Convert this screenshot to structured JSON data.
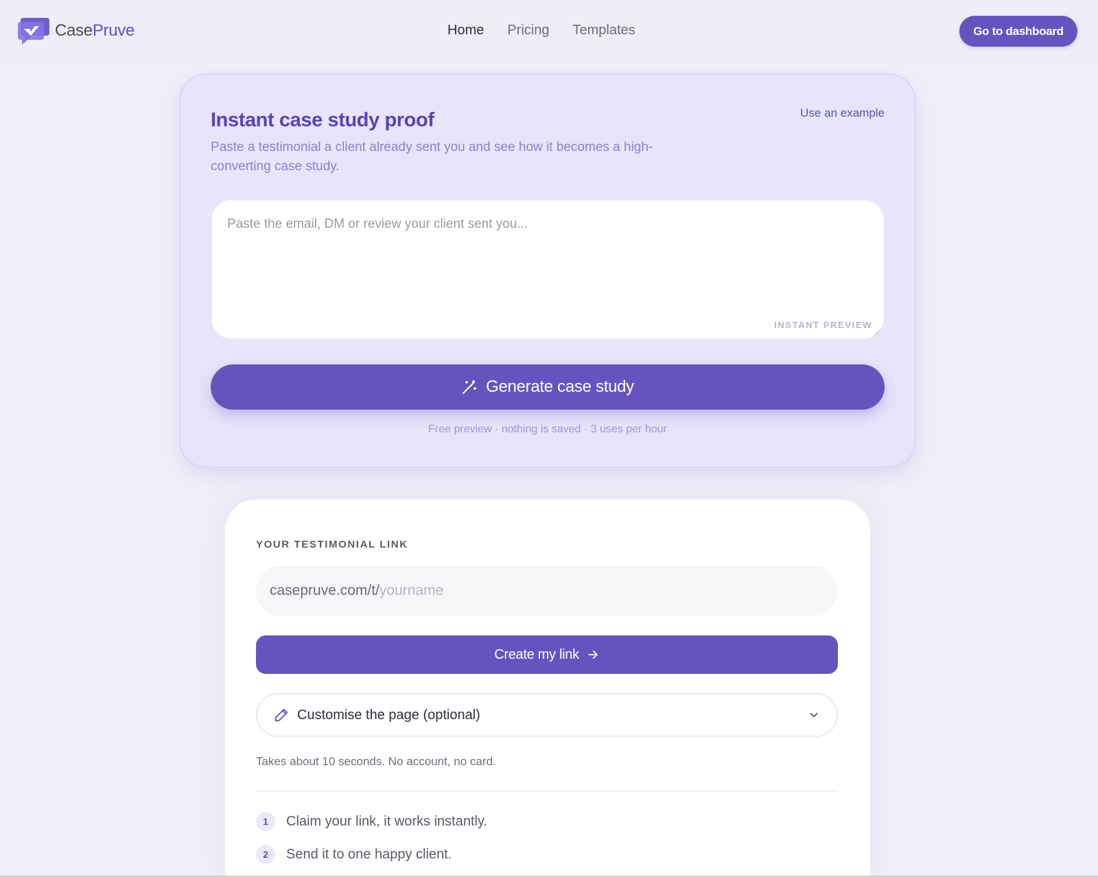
{
  "brand": {
    "case": "Case",
    "pruve": "Pruve"
  },
  "nav": {
    "home": "Home",
    "pricing": "Pricing",
    "templates": "Templates"
  },
  "header": {
    "dashboard_label": "Go to dashboard"
  },
  "case_study": {
    "title": "Instant case study proof",
    "example_link": "Use an example",
    "subtitle": "Paste a testimonial a client already sent you and see how it becomes a high-converting case study.",
    "textarea_placeholder": "Paste the email, DM or review your client sent you...",
    "instant_tag": "INSTANT PREVIEW",
    "generate_label": "Generate case study",
    "note": "Free preview · nothing is saved · 3 uses per hour"
  },
  "testimonial": {
    "label": "YOUR TESTIMONIAL LINK",
    "prefix": "casepruve.com/t/",
    "placeholder": "yourname",
    "create_label": "Create my link",
    "customise_label": "Customise the page (optional)",
    "note": "Takes about 10 seconds. No account, no card.",
    "steps": [
      {
        "num": "1",
        "text": "Claim your link, it works instantly."
      },
      {
        "num": "2",
        "text": "Send it to one happy client."
      }
    ]
  },
  "colors": {
    "accent": "#6554c0",
    "background": "#efeff9"
  },
  "icons": {
    "logo": "casepruve-logo-icon",
    "generate": "magic-wand-icon",
    "create": "arrow-right-icon",
    "customise": "pencil-icon",
    "expand": "chevron-down-icon"
  }
}
